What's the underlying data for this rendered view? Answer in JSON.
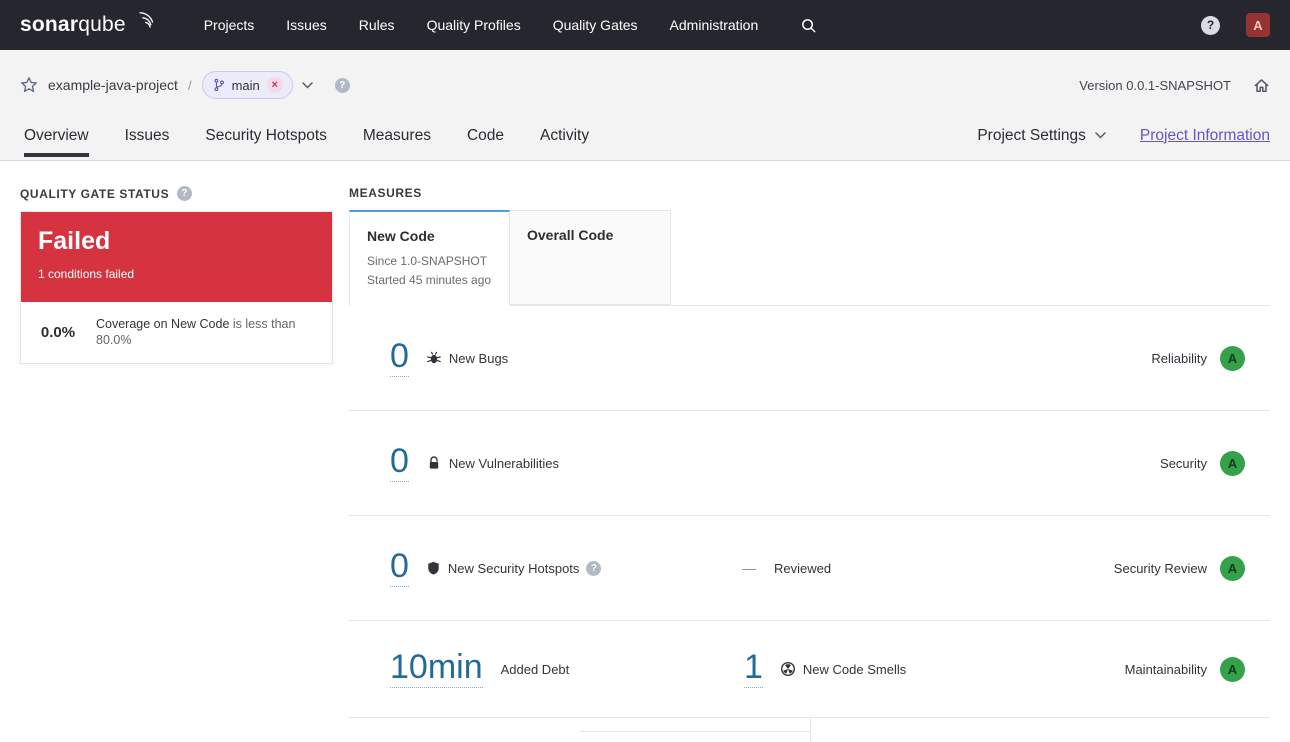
{
  "ui": {
    "question_mark": "?",
    "close_symbol": "×"
  },
  "colors": {
    "navbar_bg": "#26272e",
    "danger_red": "#d4333f",
    "rating_a_green": "#35a14b",
    "link_blue": "#236a97",
    "accent_purple": "#6a52c7",
    "active_measure_tab_top": "#4b9fd5"
  },
  "navbar": {
    "logo_sonar": "sonar",
    "logo_qube": "qube",
    "items": [
      "Projects",
      "Issues",
      "Rules",
      "Quality Profiles",
      "Quality Gates",
      "Administration"
    ],
    "avatar_initial": "A"
  },
  "breadcrumb": {
    "project_name": "example-java-project",
    "separator": "/",
    "branch_name": "main",
    "version_label": "Version 0.0.1-SNAPSHOT"
  },
  "tabs": {
    "items": [
      "Overview",
      "Issues",
      "Security Hotspots",
      "Measures",
      "Code",
      "Activity"
    ],
    "active": "Overview",
    "project_settings_label": "Project Settings",
    "project_information_label": "Project Information"
  },
  "quality_gate": {
    "section_title": "QUALITY GATE STATUS",
    "status": "Failed",
    "conditions_summary": "1 conditions failed",
    "condition": {
      "value": "0.0%",
      "metric": "Coverage on New Code",
      "requirement": "is less than 80.0%"
    }
  },
  "measures": {
    "section_title": "MEASURES",
    "tabs": {
      "new_code": {
        "label": "New Code",
        "since": "Since 1.0-SNAPSHOT",
        "started": "Started 45 minutes ago"
      },
      "overall_code": {
        "label": "Overall Code"
      }
    },
    "rows": [
      {
        "value": "0",
        "label": "New Bugs",
        "domain": "Reliability",
        "rating": "A"
      },
      {
        "value": "0",
        "label": "New Vulnerabilities",
        "domain": "Security",
        "rating": "A"
      },
      {
        "value": "0",
        "label": "New Security Hotspots",
        "reviewed_dash": "—",
        "reviewed_label": "Reviewed",
        "domain": "Security Review",
        "rating": "A"
      },
      {
        "value": "10min",
        "label": "Added Debt",
        "value2": "1",
        "label2": "New Code Smells",
        "domain": "Maintainability",
        "rating": "A"
      }
    ]
  }
}
